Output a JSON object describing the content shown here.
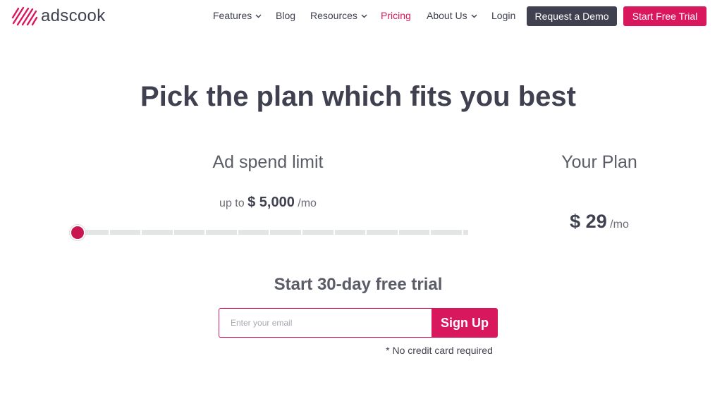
{
  "header": {
    "logo_text": "adscook",
    "nav": [
      {
        "label": "Features",
        "has_dropdown": true
      },
      {
        "label": "Blog",
        "has_dropdown": false
      },
      {
        "label": "Resources",
        "has_dropdown": true
      },
      {
        "label": "Pricing",
        "has_dropdown": false,
        "active": true
      },
      {
        "label": "About Us",
        "has_dropdown": true
      },
      {
        "label": "Login",
        "has_dropdown": false
      }
    ],
    "demo_button": "Request a Demo",
    "trial_button": "Start Free Trial"
  },
  "hero": {
    "headline": "Pick the plan which fits you best"
  },
  "spend": {
    "label": "Ad spend limit",
    "prefix": "up to",
    "amount": "$ 5,000",
    "suffix": "/mo",
    "slider_level": 0
  },
  "plan": {
    "label": "Your Plan",
    "price": "$ 29",
    "suffix": "/mo"
  },
  "trial": {
    "title": "Start 30-day free trial",
    "email_placeholder": "Enter your email",
    "signup_button": "Sign Up",
    "note": "* No credit card required"
  },
  "colors": {
    "brand": "#d9175c",
    "dark": "#3f4150",
    "slider_thumb": "#c8154f",
    "track": "#e3e5e5"
  },
  "icons": {
    "logo": "adscook-stripes-logo-icon",
    "dropdown": "chevron-down-icon"
  }
}
